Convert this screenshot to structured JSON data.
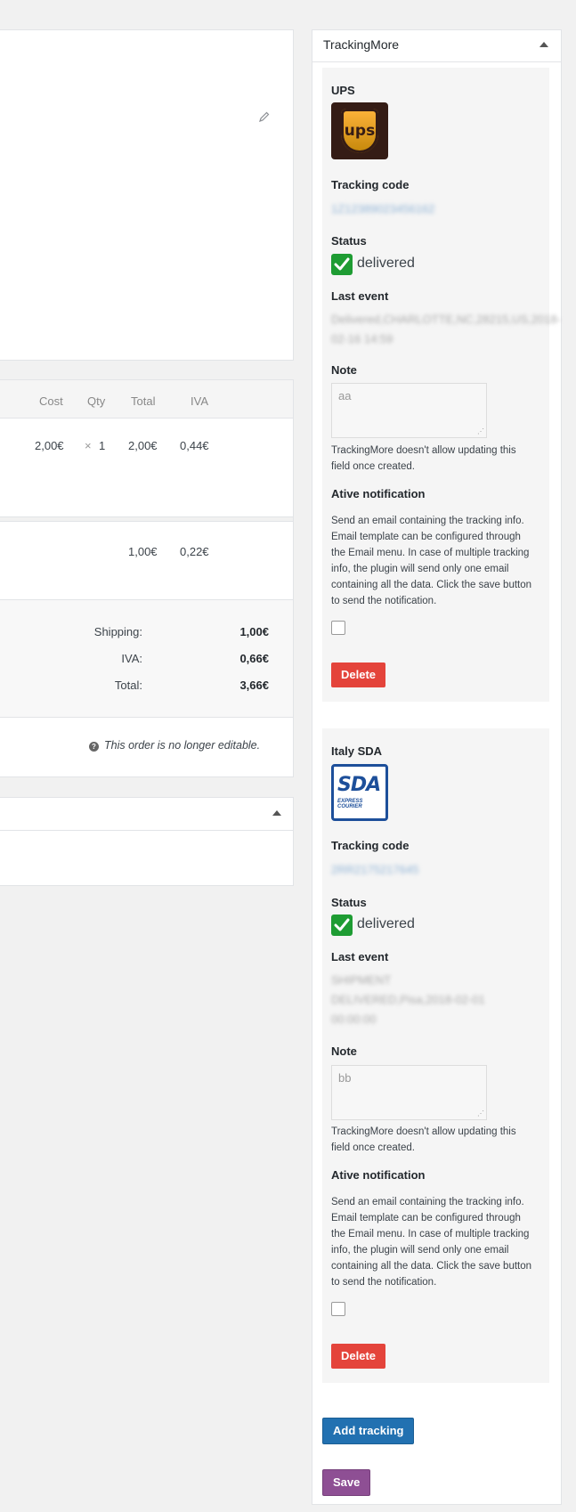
{
  "left": {
    "table_headers": [
      "Cost",
      "Qty",
      "Total",
      "IVA"
    ],
    "item_row": {
      "cost": "2,00€",
      "qty_mark": "×",
      "qty": "1",
      "total": "2,00€",
      "iva": "0,44€"
    },
    "shipping_row": {
      "total": "1,00€",
      "iva": "0,22€"
    },
    "totals": [
      {
        "label": "Shipping:",
        "value": "1,00€"
      },
      {
        "label": "IVA:",
        "value": "0,66€"
      },
      {
        "label": "Total:",
        "value": "3,66€"
      }
    ],
    "not_editable": "This order is no longer editable."
  },
  "sidebar": {
    "title": "TrackingMore",
    "labels": {
      "tracking_code": "Tracking code",
      "status": "Status",
      "last_event": "Last event",
      "note": "Note",
      "note_help": "TrackingMore doesn't allow updating this field once created.",
      "notification": "Ative notification",
      "notification_help": "Send an email containing the tracking info. Email template can be configured through the Email menu. In case of multiple tracking info, the plugin will send only one email containing all the data. Click the save button to send the notification.",
      "delete": "Delete"
    },
    "trackings": [
      {
        "carrier": "UPS",
        "logo_icon": "ups-logo-icon",
        "code": "1Z12389023456162",
        "status": "delivered",
        "last_event": "Delivered,CHARLOTTE,NC,28215,US,2018-02-16 14:59",
        "note": "aa"
      },
      {
        "carrier": "Italy SDA",
        "logo_icon": "sda-logo-icon",
        "code": "2RR2175217645",
        "status": "delivered",
        "last_event": "SHIPMENT DELIVERED,Pisa,2018-02-01 00:00:00",
        "note": "bb"
      }
    ],
    "add_tracking": "Add tracking",
    "save": "Save"
  },
  "colors": {
    "delete": "#e4443b",
    "add": "#2271b1",
    "save": "#8e4f94",
    "status_ok": "#1e9c33"
  }
}
